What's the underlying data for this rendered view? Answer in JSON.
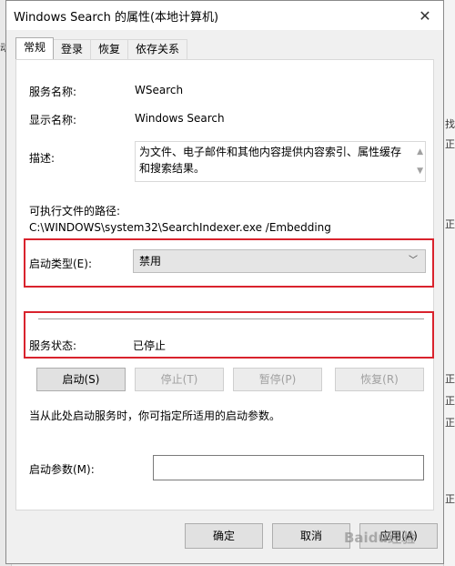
{
  "window": {
    "title": "Windows Search 的属性(本地计算机)",
    "close_glyph": "✕"
  },
  "background": {
    "left_fragments": [
      "动"
    ],
    "right_fragments": [
      "找",
      "正",
      "正",
      "正",
      "正",
      "正",
      "正"
    ]
  },
  "tabs": [
    {
      "label": "常规",
      "active": true
    },
    {
      "label": "登录",
      "active": false
    },
    {
      "label": "恢复",
      "active": false
    },
    {
      "label": "依存关系",
      "active": false
    }
  ],
  "general": {
    "service_name_label": "服务名称:",
    "service_name_value": "WSearch",
    "display_name_label": "显示名称:",
    "display_name_value": "Windows Search",
    "description_label": "描述:",
    "description_value": "为文件、电子邮件和其他内容提供内容索引、属性缓存和搜索结果。",
    "exec_path_label": "可执行文件的路径:",
    "exec_path_value": "C:\\WINDOWS\\system32\\SearchIndexer.exe /Embedding",
    "startup_type_label": "启动类型(E):",
    "startup_type_value": "禁用",
    "service_status_label": "服务状态:",
    "service_status_value": "已停止",
    "buttons": {
      "start": "启动(S)",
      "stop": "停止(T)",
      "pause": "暂停(P)",
      "resume": "恢复(R)"
    },
    "hint": "当从此处启动服务时，你可指定所适用的启动参数。",
    "start_params_label": "启动参数(M):",
    "start_params_value": ""
  },
  "footer": {
    "ok": "确定",
    "cancel": "取消",
    "apply": "应用(A)"
  },
  "watermark": "Baidu经验",
  "colors": {
    "highlight": "#d9232d",
    "accent": "#0078d7"
  }
}
